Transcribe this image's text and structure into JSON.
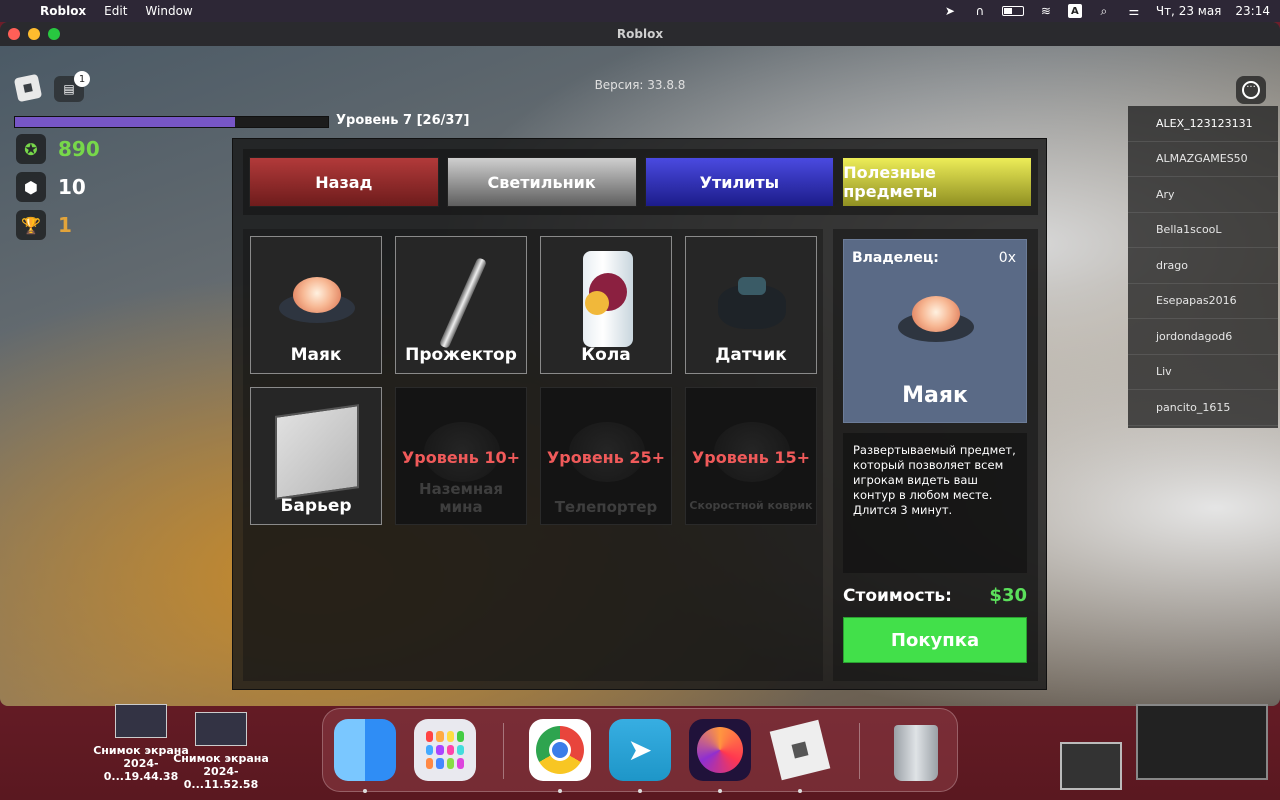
{
  "menubar": {
    "app": "Roblox",
    "items": [
      "Edit",
      "Window"
    ],
    "datetime_day": "Чт, 23 мая",
    "datetime_time": "23:14",
    "input_lang": "A"
  },
  "window": {
    "title": "Roblox"
  },
  "hud": {
    "version": "Версия: 33.8.8",
    "chat_badge": "1",
    "level_text": "Уровень 7 [26/37]",
    "level_progress": 0.703,
    "coins": "890",
    "cubes": "10",
    "trophies": "1",
    "colors": {
      "level": "#7756c6",
      "coins": "#77d84a",
      "trophy": "#e3a43a"
    }
  },
  "shop": {
    "tabs": [
      {
        "label": "Назад",
        "color": "#b23a3a"
      },
      {
        "label": "Светильник",
        "color": "#cfcfcf"
      },
      {
        "label": "Утилиты",
        "color": "#4a4ae0"
      },
      {
        "label": "Полезные предметы",
        "color": "#eded58"
      }
    ],
    "items": [
      {
        "name": "Маяк",
        "locked": false
      },
      {
        "name": "Прожектор",
        "locked": false
      },
      {
        "name": "Кола",
        "locked": false
      },
      {
        "name": "Датчик",
        "locked": false
      },
      {
        "name": "Барьер",
        "locked": false
      },
      {
        "name": "Наземная мина",
        "locked": true,
        "requirement": "Уровень 10+"
      },
      {
        "name": "Телепортер",
        "locked": true,
        "requirement": "Уровень 25+"
      },
      {
        "name": "Скоростной коврик",
        "locked": true,
        "requirement": "Уровень 15+"
      }
    ],
    "detail": {
      "owner_label": "Владелец:",
      "owner_count": "0x",
      "name": "Маяк",
      "description": "Развертываемый предмет, который позволяет всем игрокам видеть ваш контур в любом месте. Длится 3 минут.",
      "cost_label": "Стоимость:",
      "cost_value": "$30",
      "buy_label": "Покупка"
    }
  },
  "players": [
    "ALEX_123123131",
    "ALMAZGAMES50",
    "Ary",
    "Bella1scooL",
    "drago",
    "Esepapas2016",
    "jordondagod6",
    "Liv",
    "pancito_1615"
  ],
  "desktop": {
    "files": [
      {
        "name": "Снимок экрана",
        "date": "2024-0...19.44.38"
      },
      {
        "name": "Снимок экрана",
        "date": "2024-0...11.52.58"
      }
    ]
  },
  "dock": {
    "apps": [
      "finder-icon",
      "launchpad-icon",
      "chrome-icon",
      "telegram-icon",
      "firefox-icon",
      "roblox-icon",
      "trash-icon"
    ]
  }
}
